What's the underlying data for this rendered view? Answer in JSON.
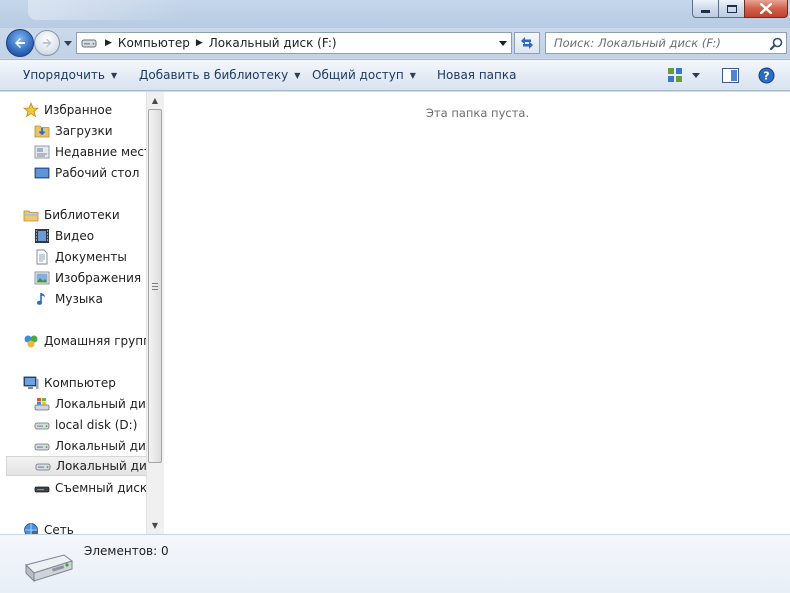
{
  "window": {
    "caption_buttons": [
      "minimize",
      "maximize",
      "close"
    ]
  },
  "navigation": {
    "back_icon": "back-arrow-icon",
    "forward_icon": "forward-arrow-icon",
    "breadcrumb": [
      "Компьютер",
      "Локальный диск (F:)"
    ],
    "search_placeholder": "Поиск: Локальный диск (F:)"
  },
  "toolbar": {
    "organize": "Упорядочить",
    "add_to_library": "Добавить в библиотеку",
    "share": "Общий доступ",
    "new_folder": "Новая папка"
  },
  "sidebar": {
    "favorites": {
      "label": "Избранное",
      "items": [
        "Загрузки",
        "Недавние места",
        "Рабочий стол"
      ]
    },
    "libraries": {
      "label": "Библиотеки",
      "items": [
        "Видео",
        "Документы",
        "Изображения",
        "Музыка"
      ]
    },
    "homegroup": {
      "label": "Домашняя группа"
    },
    "computer": {
      "label": "Компьютер",
      "items": [
        "Локальный диск",
        "local disk (D:)",
        "Локальный диск",
        "Локальный диск",
        "Съемный диск ("
      ]
    },
    "network": {
      "label": "Сеть"
    }
  },
  "content": {
    "empty_message": "Эта папка пуста."
  },
  "details": {
    "items_count": "Элементов: 0"
  },
  "colors": {
    "frame": "#cfdbe9",
    "accent_blue": "#2a63b8",
    "command_text": "#1e395b",
    "selection_bg": "#e3e3e3"
  }
}
